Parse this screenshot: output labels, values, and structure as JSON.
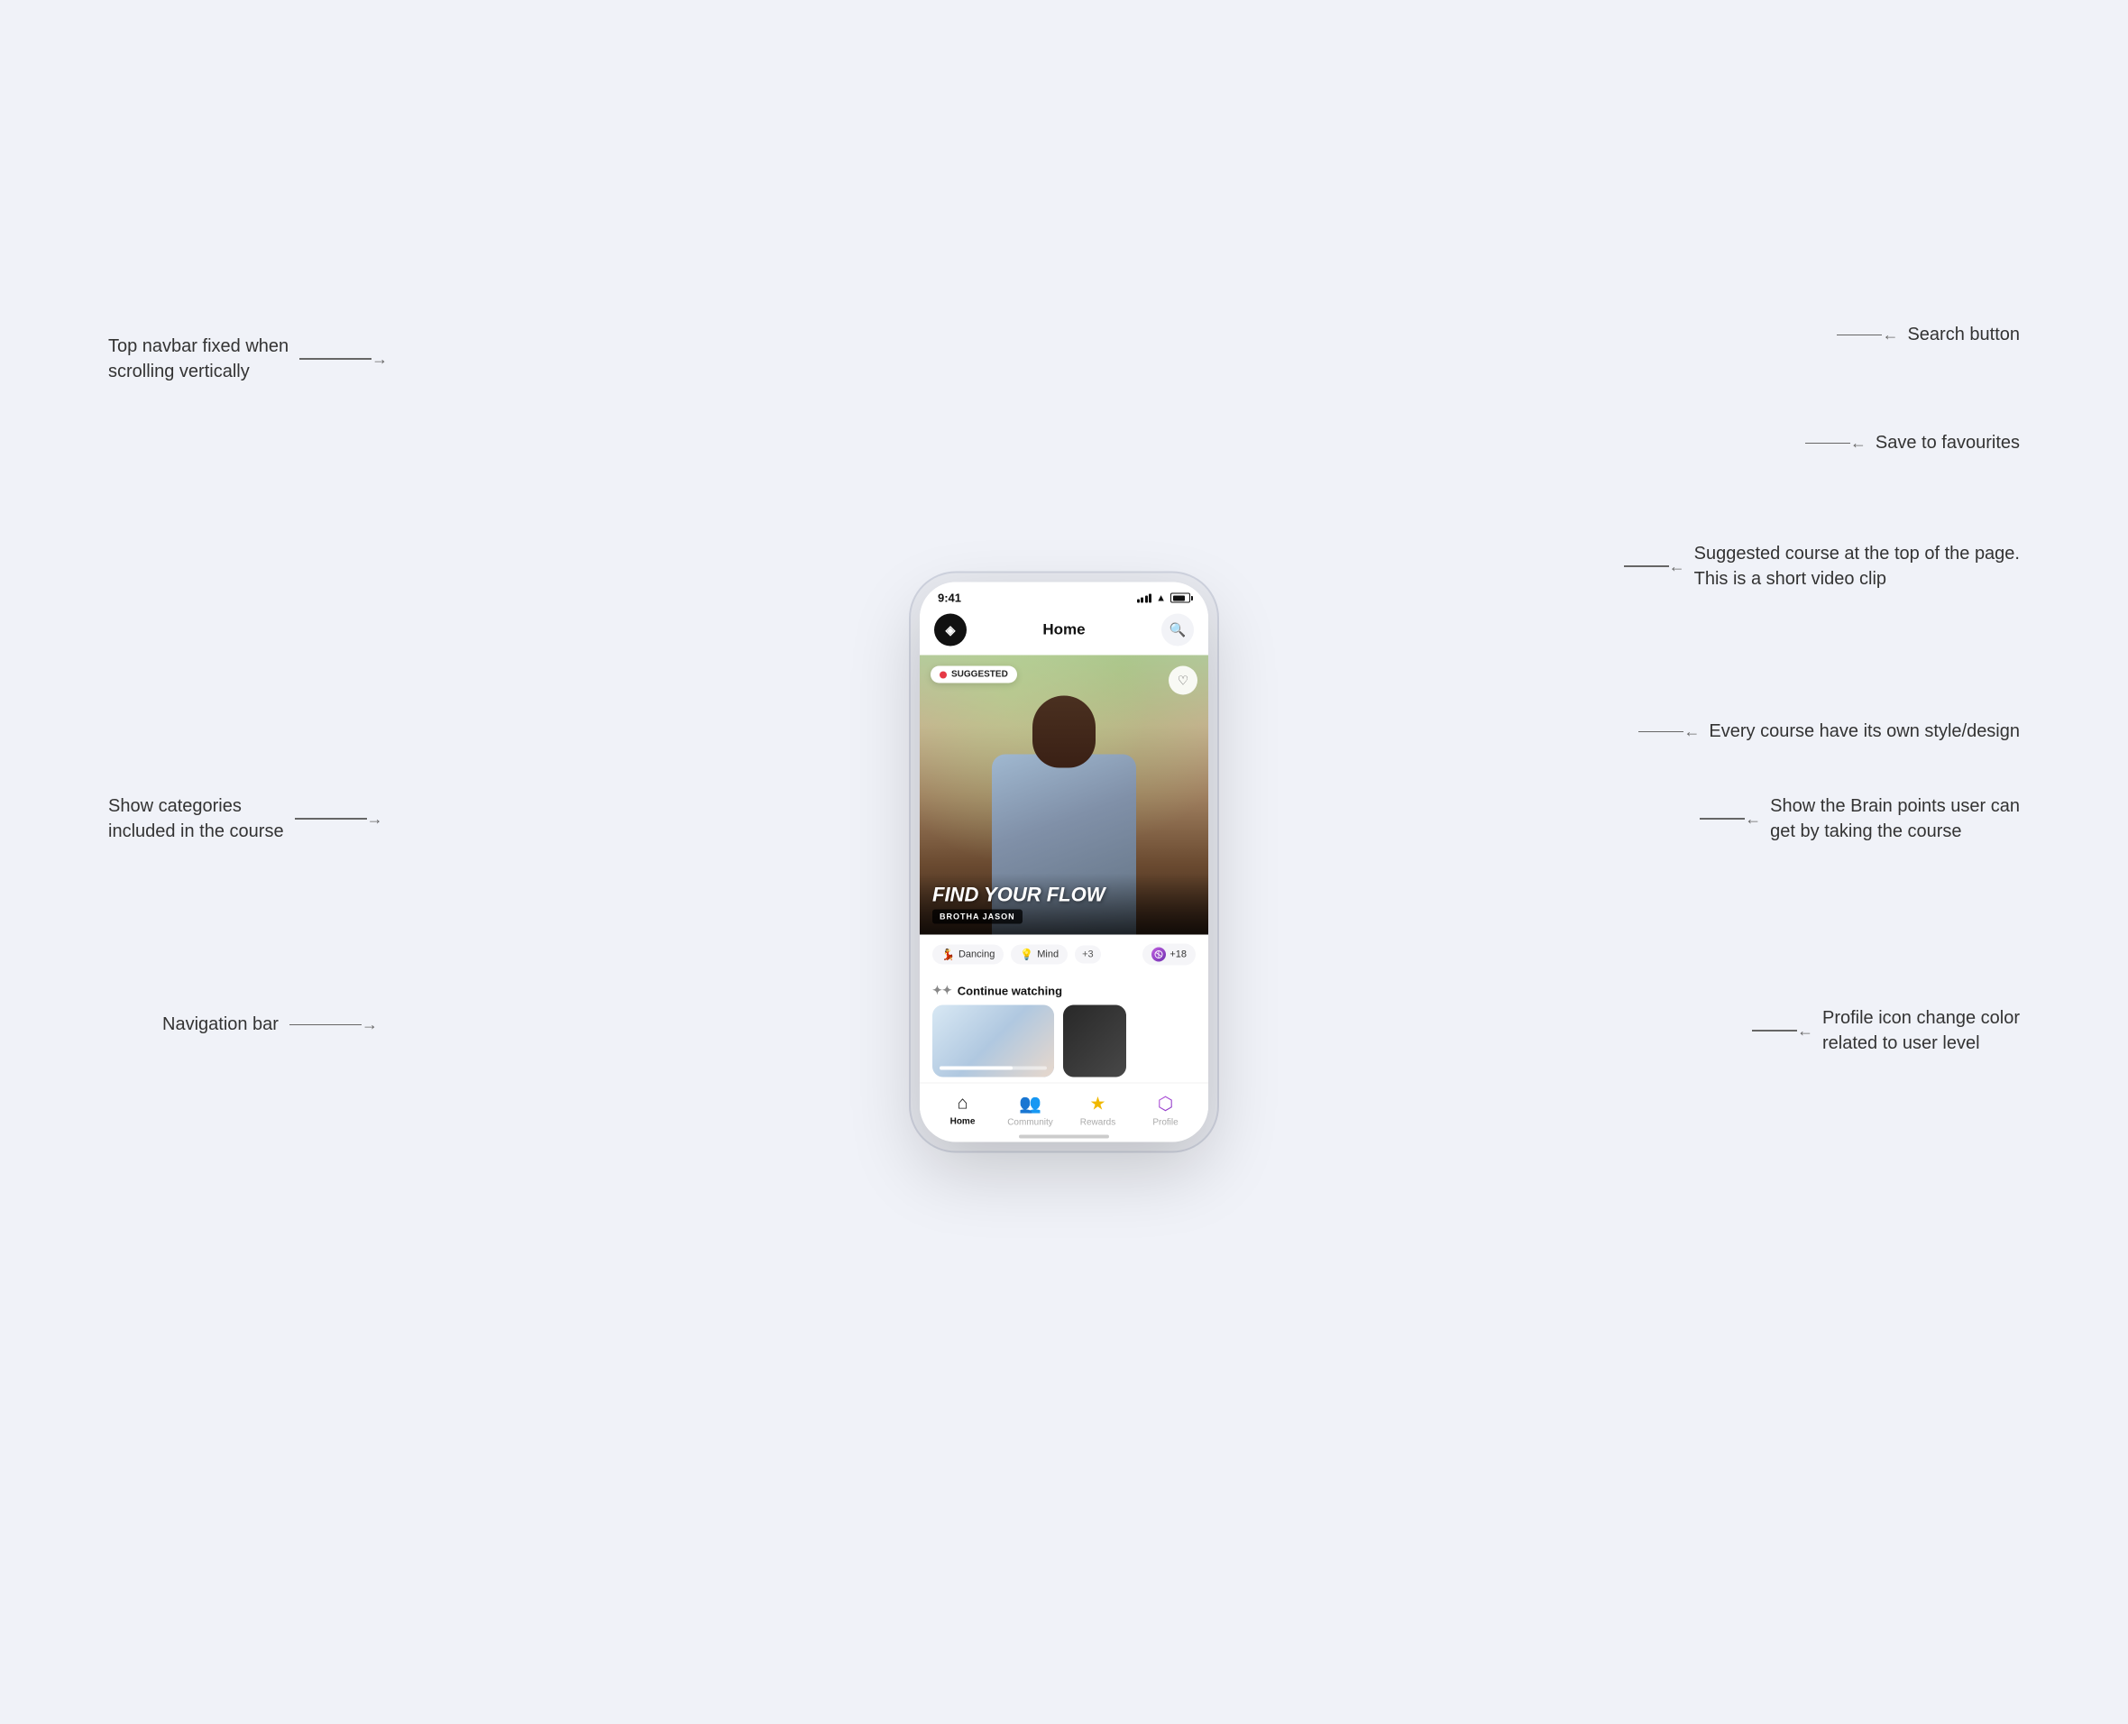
{
  "page": {
    "bg_color": "#eef0f6"
  },
  "annotations": {
    "top_navbar": {
      "text": "Top navbar fixed when\nscrolling vertically",
      "side": "left"
    },
    "search_button": {
      "text": "Search button",
      "side": "right"
    },
    "save_favourites": {
      "text": "Save to favourites",
      "side": "right"
    },
    "suggested_course": {
      "text": "Suggested course at the top of the page.\nThis is a short video clip",
      "side": "right"
    },
    "course_design": {
      "text": "Every course have its own style/design",
      "side": "right"
    },
    "show_categories": {
      "text": "Show categories\nincluded in the course",
      "side": "left"
    },
    "brain_points": {
      "text": "Show the Brain points user can\nget by taking the course",
      "side": "right"
    },
    "navigation_bar": {
      "text": "Navigation bar",
      "side": "left"
    },
    "profile_icon": {
      "text": "Profile icon change color\nrelated to user level",
      "side": "right"
    }
  },
  "phone": {
    "status_bar": {
      "time": "9:41"
    },
    "navbar": {
      "title": "Home"
    },
    "hero": {
      "badge": "SUGGESTED",
      "course_title": "Find Your Flow",
      "author": "Brotha Jason"
    },
    "categories": [
      {
        "icon": "💃",
        "label": "Dancing"
      },
      {
        "icon": "💡",
        "label": "Mind"
      }
    ],
    "more_count": "+3",
    "brain_points": "+18",
    "continue_section_title": "Continue watching",
    "nav_items": [
      {
        "label": "Home",
        "active": true
      },
      {
        "label": "Community",
        "active": false
      },
      {
        "label": "Rewards",
        "active": false
      },
      {
        "label": "Profile",
        "active": false
      }
    ]
  }
}
